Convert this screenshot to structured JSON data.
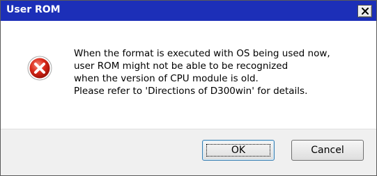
{
  "window": {
    "title": "User ROM",
    "close_icon": "close-x-icon",
    "title_bar_color": "#1c2fb8"
  },
  "message": {
    "icon": "error-icon",
    "lines": [
      "When the format is executed with OS being used now,",
      "user ROM might not be able to be recognized",
      "when the version of CPU module is old.",
      "Please refer to 'Directions of D300win' for details."
    ]
  },
  "buttons": {
    "ok_label": "OK",
    "cancel_label": "Cancel"
  }
}
